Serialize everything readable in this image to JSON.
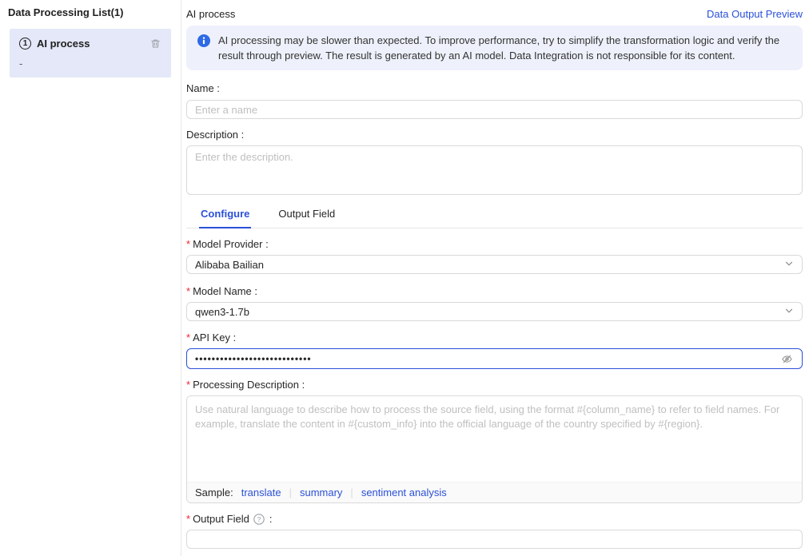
{
  "accent_color": "#2b50d8",
  "banner_bg": "#eef1fb",
  "selected_item_bg": "#e4e8f8",
  "required_marker": "*",
  "sidebar": {
    "title": "Data Processing List(1)",
    "items": [
      {
        "index": "1",
        "label": "AI process",
        "sublabel": "-",
        "selected": true
      }
    ]
  },
  "header": {
    "title": "AI process",
    "preview_link": "Data Output Preview"
  },
  "banner": {
    "text": "AI processing may be slower than expected. To improve performance, try to simplify the transformation logic and verify the result through preview. The result is generated by an AI model. Data Integration is not responsible for its content."
  },
  "form": {
    "name": {
      "label": "Name :",
      "placeholder": "Enter a name",
      "value": ""
    },
    "description": {
      "label": "Description :",
      "placeholder": "Enter the description.",
      "value": ""
    },
    "tabs": [
      {
        "label": "Configure",
        "active": true
      },
      {
        "label": "Output Field",
        "active": false
      }
    ],
    "model_provider": {
      "label": "Model Provider :",
      "required": true,
      "value": "Alibaba Bailian"
    },
    "model_name": {
      "label": "Model Name :",
      "required": true,
      "value": "qwen3-1.7b"
    },
    "api_key": {
      "label": "API Key :",
      "required": true,
      "masked_value": "••••••••••••••••••••••••••••"
    },
    "processing_description": {
      "label": "Processing Description :",
      "required": true,
      "placeholder": "Use natural language to describe how to process the source field, using the format #{column_name} to refer to field names. For example, translate the content in #{custom_info} into the official language of the country specified by #{region}.",
      "sample_label": "Sample:",
      "sample_separator": "|",
      "samples": [
        "translate",
        "summary",
        "sentiment analysis"
      ]
    },
    "output_field": {
      "label": "Output Field",
      "label_colon": ":",
      "required": true,
      "value": ""
    }
  }
}
